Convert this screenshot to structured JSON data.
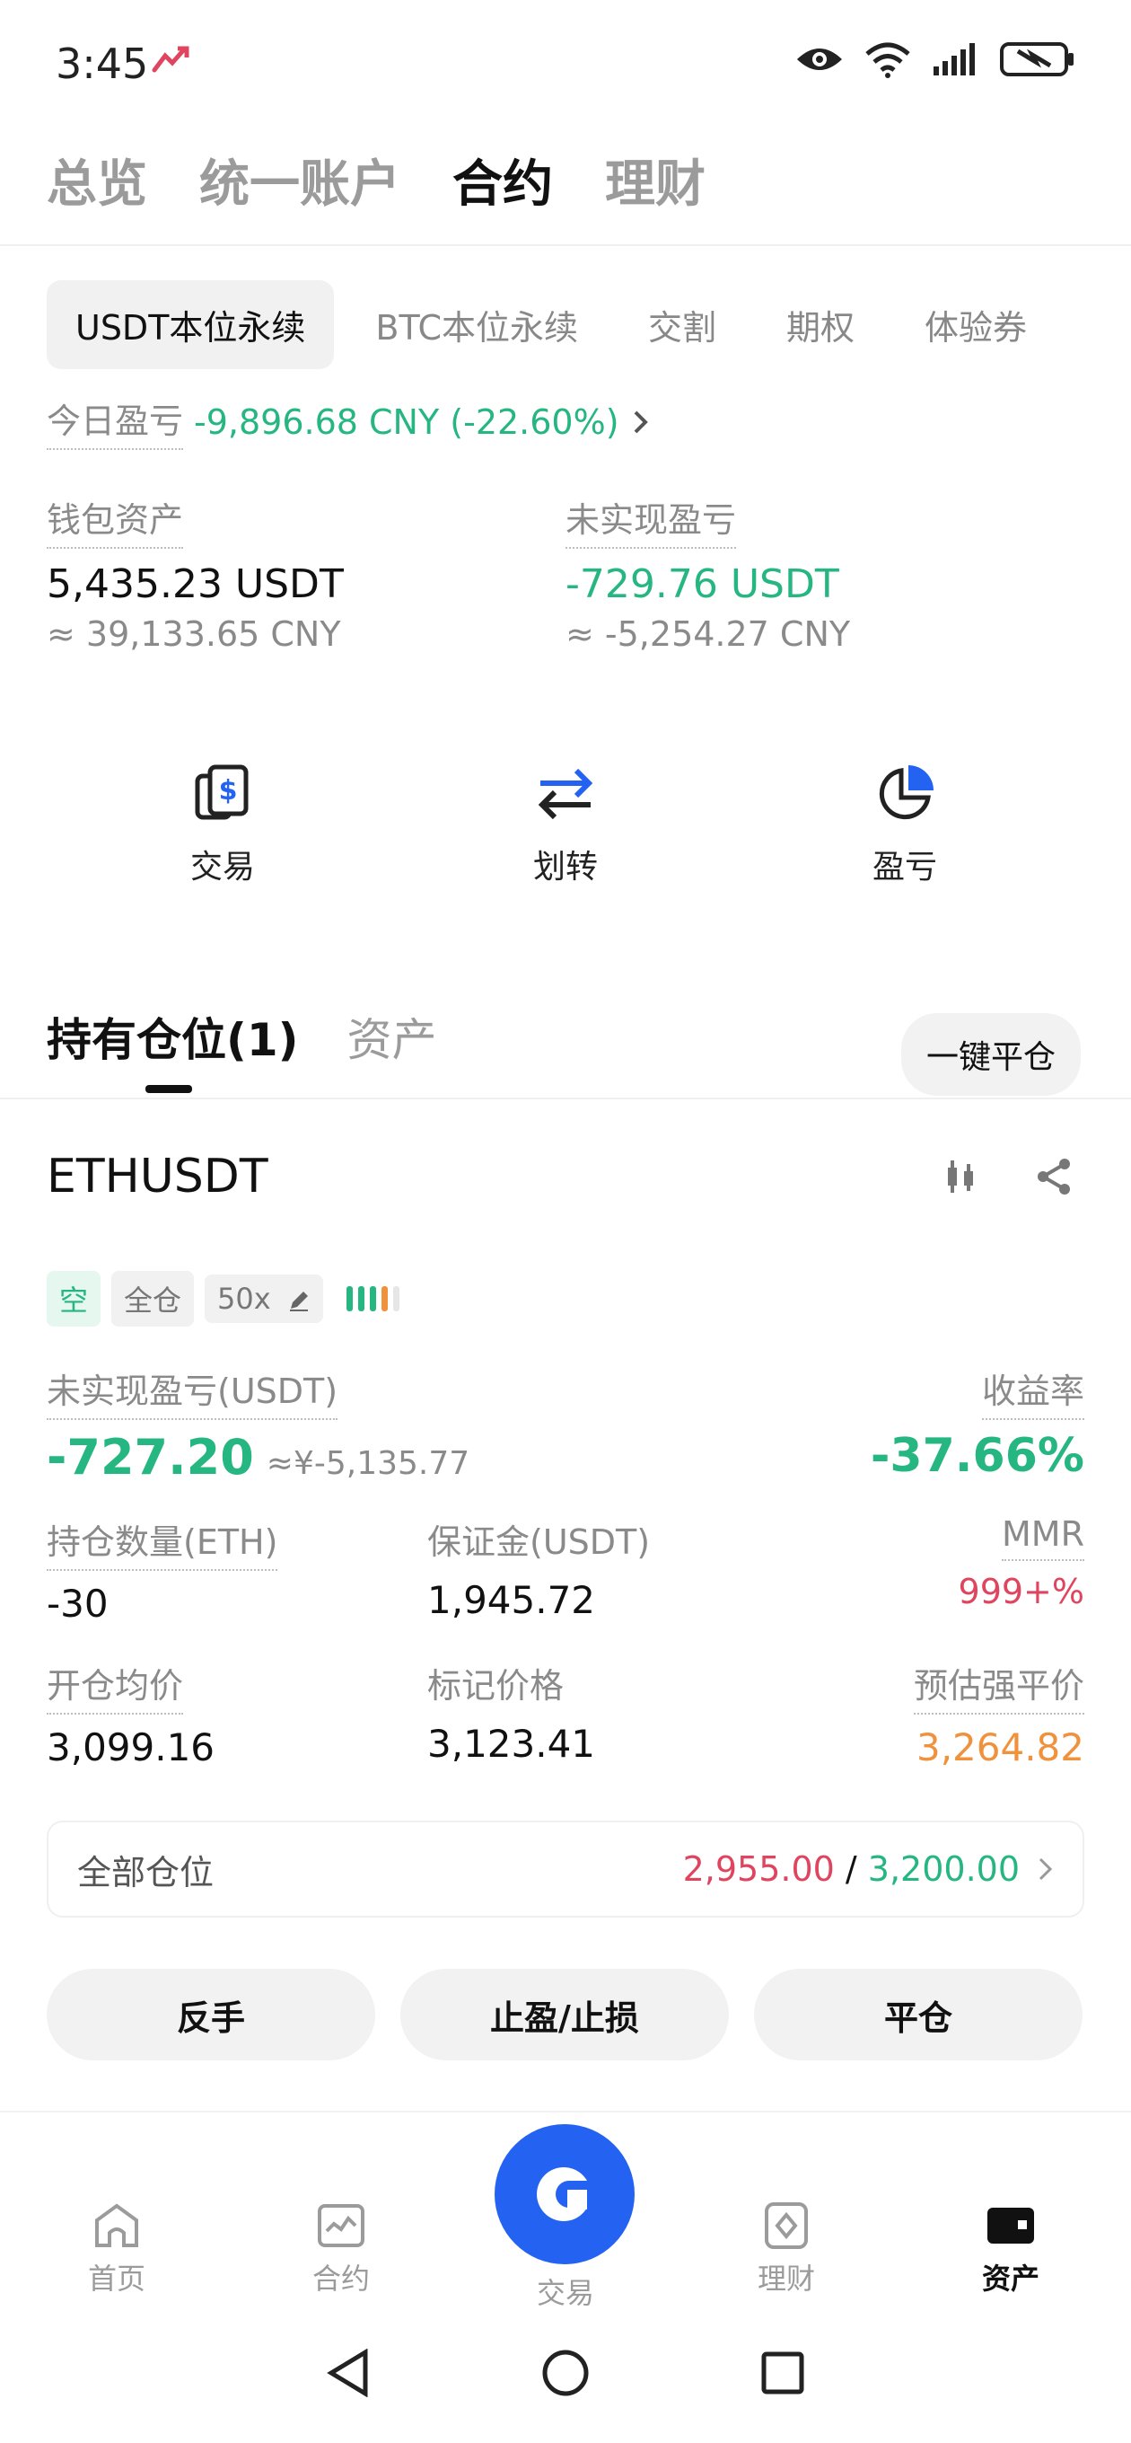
{
  "status": {
    "time": "3:45"
  },
  "topnav": {
    "items": [
      "总览",
      "统一账户",
      "合约",
      "理财"
    ],
    "active_index": 2
  },
  "subtabs": [
    "USDT本位永续",
    "BTC本位永续",
    "交割",
    "期权",
    "体验券"
  ],
  "today_pnl": {
    "label": "今日盈亏",
    "value": "-9,896.68 CNY (-22.60%)"
  },
  "wallet": {
    "label": "钱包资产",
    "value": "5,435.23 USDT",
    "sub": "≈ 39,133.65 CNY"
  },
  "unrealized": {
    "label": "未实现盈亏",
    "value": "-729.76 USDT",
    "sub": "≈ -5,254.27 CNY"
  },
  "actions": {
    "trade": "交易",
    "transfer": "划转",
    "pnl": "盈亏"
  },
  "positions": {
    "tab_holdings": "持有仓位(1)",
    "tab_assets": "资产",
    "close_all": "一键平仓"
  },
  "position": {
    "symbol": "ETHUSDT",
    "tags": {
      "side": "空",
      "margin": "全仓",
      "leverage": "50x"
    },
    "upnl_label": "未实现盈亏(USDT)",
    "upnl_value": "-727.20",
    "upnl_cny": "≈¥-5,135.77",
    "roe_label": "收益率",
    "roe_value": "-37.66%",
    "size_label": "持仓数量(ETH)",
    "size_value": "-30",
    "margin_label": "保证金(USDT)",
    "margin_value": "1,945.72",
    "mmr_label": "MMR",
    "mmr_value": "999+%",
    "entry_label": "开仓均价",
    "entry_value": "3,099.16",
    "mark_label": "标记价格",
    "mark_value": "3,123.41",
    "liq_label": "预估强平价",
    "liq_value": "3,264.82",
    "all_label": "全部仓位",
    "tp_value": "2,955.00",
    "sep": " / ",
    "sl_value": "3,200.00",
    "btn_reverse": "反手",
    "btn_tpsl": "止盈/止损",
    "btn_close": "平仓"
  },
  "bottomnav": {
    "home": "首页",
    "futures": "合约",
    "trade": "交易",
    "earn": "理财",
    "assets": "资产"
  },
  "colors": {
    "green": "#25b681",
    "red": "#e0455f",
    "orange": "#f0913c",
    "blue": "#2463f2"
  }
}
